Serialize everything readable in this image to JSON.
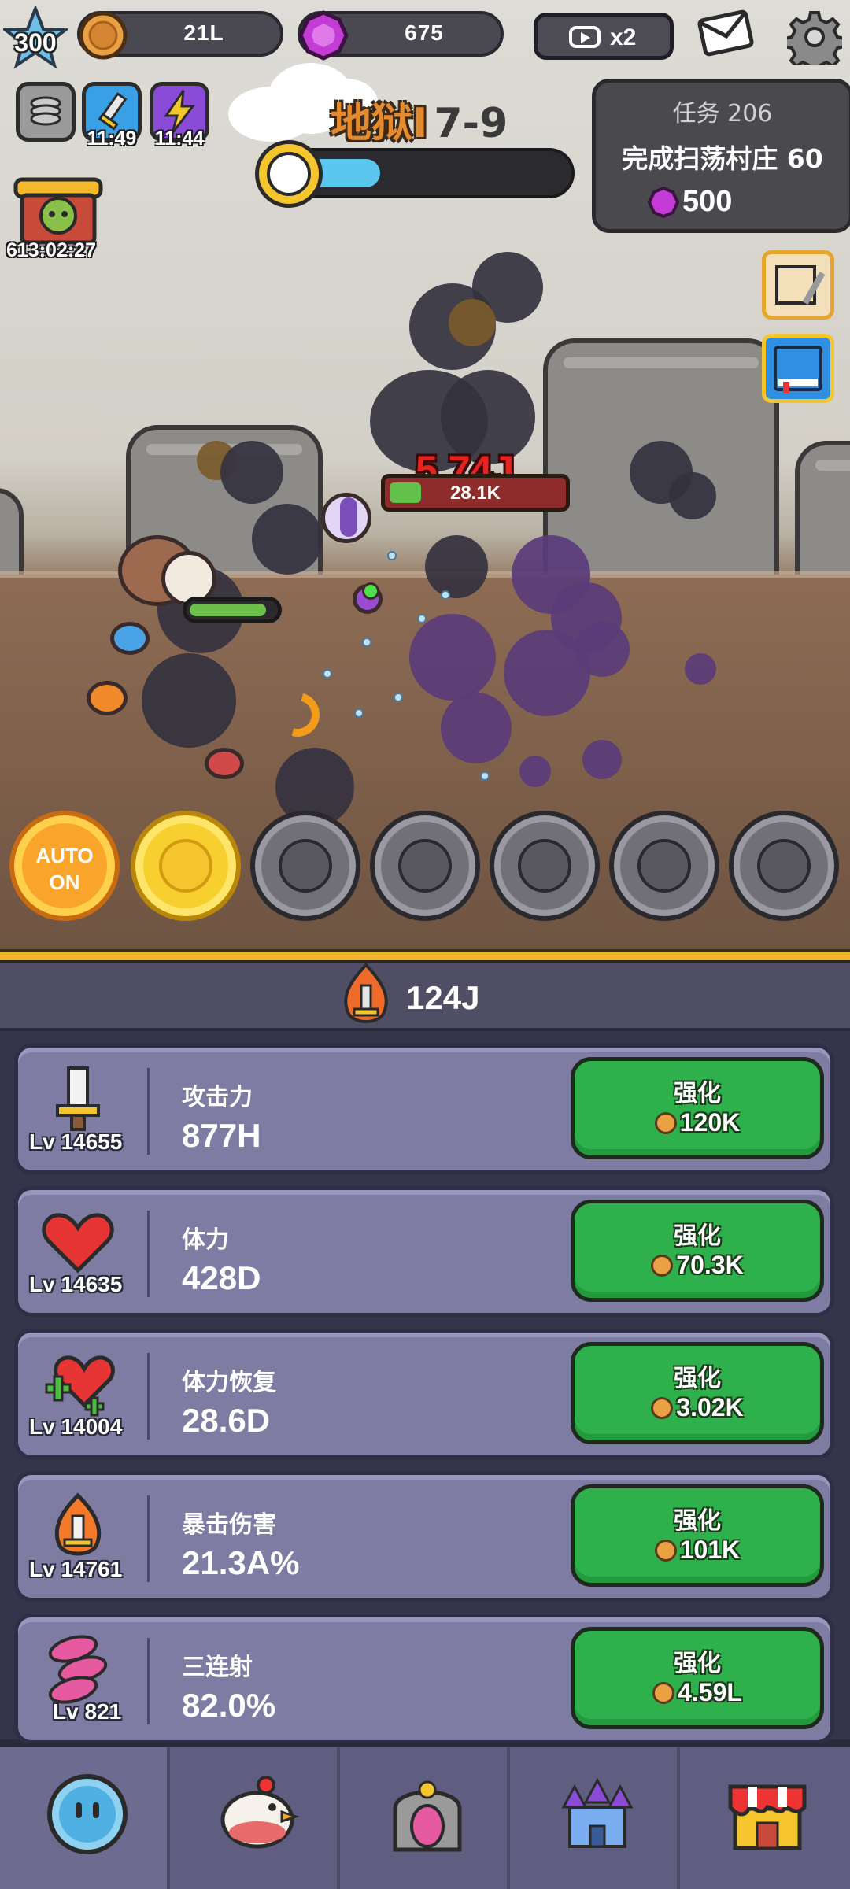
{
  "hud": {
    "player_level": "300",
    "coins": "21L",
    "gems": "675",
    "ad_multiplier": "x2",
    "buff_timers": [
      "11:49",
      "11:44"
    ],
    "boss_timer": "613:02:27"
  },
  "stage": {
    "mode": "地狱I",
    "level": "7-9",
    "progress": 0.33
  },
  "quest": {
    "title": "任务 206",
    "description": "完成扫荡村庄 60",
    "reward": "500"
  },
  "battle": {
    "damage_text": "5.74J",
    "enemy_hp_label": "28.1K",
    "enemy_hp_fraction": 0.06,
    "player_hp_fraction": 0.9
  },
  "skills": {
    "auto_label_line1": "AUTO",
    "auto_label_line2": "ON",
    "icons": [
      "flame-skill-icon",
      "blob-skill-icon",
      "bat-skill-icon",
      "claw-skill-icon",
      "totem-skill-icon",
      "vortex-skill-icon"
    ]
  },
  "power": {
    "value": "124J"
  },
  "upgrades": [
    {
      "name": "攻击力",
      "level": "Lv 14655",
      "value": "877H",
      "button": "强化",
      "cost": "120K",
      "icon": "sword-icon"
    },
    {
      "name": "体力",
      "level": "Lv 14635",
      "value": "428D",
      "button": "强化",
      "cost": "70.3K",
      "icon": "heart-icon"
    },
    {
      "name": "体力恢复",
      "level": "Lv 14004",
      "value": "28.6D",
      "button": "强化",
      "cost": "3.02K",
      "icon": "heart-plus-icon"
    },
    {
      "name": "暴击伤害",
      "level": "Lv 14761",
      "value": "21.3A%",
      "button": "强化",
      "cost": "101K",
      "icon": "flaming-sword-icon"
    },
    {
      "name": "三连射",
      "level": "Lv 821",
      "value": "82.0%",
      "button": "强化",
      "cost": "4.59L",
      "icon": "triple-shot-icon"
    }
  ],
  "nav": [
    "slime-icon",
    "chicken-icon",
    "portal-icon",
    "castle-icon",
    "shop-icon"
  ],
  "colors": {
    "accent_green": "#2eb14c",
    "panel_purple": "#7e7ca3",
    "gold": "#f0b429",
    "progress_blue": "#5cc7ee"
  }
}
